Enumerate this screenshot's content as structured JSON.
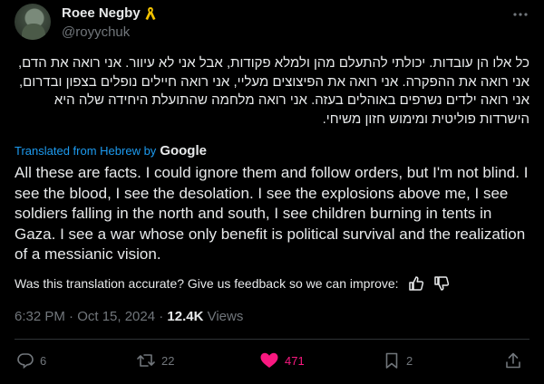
{
  "author": {
    "display_name": "Roee Negby",
    "handle": "@royychuk",
    "badge_icon": "yellow-ribbon-icon"
  },
  "post": {
    "original_text": "כל אלו הן עובדות. יכולתי להתעלם מהן ולמלא פקודות, אבל אני לא עיוור. אני רואה את הדם, אני רואה את ההפקרה. אני רואה את הפיצוצים מעליי, אני רואה חיילים נופלים בצפון ובדרום, אני רואה ילדים נשרפים באוהלים בעזה. אני רואה מלחמה שהתועלת היחידה שלה היא הישרדות פוליטית ומימוש חזון משיחי.",
    "translated_label": "Translated from Hebrew by",
    "translator": "Google",
    "translated_text": "All these are facts. I could ignore them and follow orders, but I'm not blind. I see the blood, I see the desolation. I see the explosions above me, I see soldiers falling in the north and south, I see children burning in tents in Gaza. I see a war whose only benefit is political survival and the realization of a messianic vision.",
    "feedback_prompt": "Was this translation accurate? Give us feedback so we can improve:",
    "timestamp": "6:32 PM · Oct 15, 2024 · ",
    "views_count": "12.4K",
    "views_label": " Views"
  },
  "actions": {
    "replies": "6",
    "reposts": "22",
    "likes": "471",
    "bookmarks": "2"
  },
  "colors": {
    "background": "#000000",
    "text": "#e7e9ea",
    "muted": "#71767b",
    "link": "#1d9bf0",
    "like": "#f91880",
    "ribbon": "#f5c400"
  }
}
